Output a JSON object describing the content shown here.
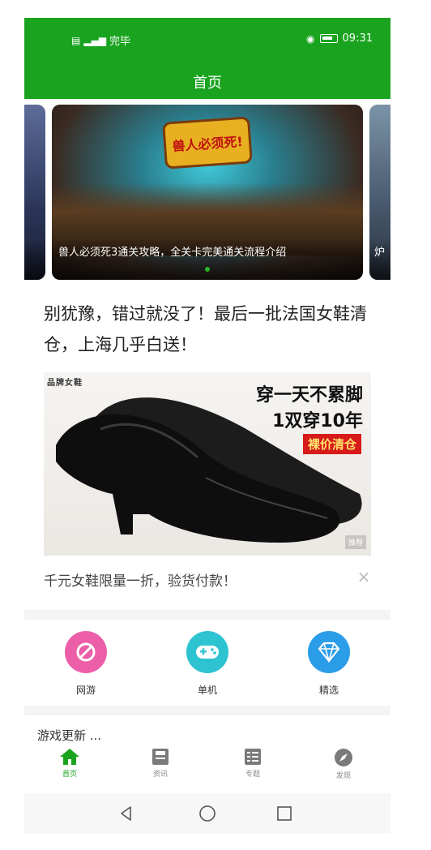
{
  "status_bar": {
    "left_text": "完毕",
    "time": "09:31"
  },
  "app_bar": {
    "title": "首页"
  },
  "carousel": {
    "left_caption": "...",
    "main_logo_text": "兽人必须死!",
    "main_caption": "兽人必须死3通关攻略，全关卡完美通关流程介绍",
    "right_caption": "炉"
  },
  "ad": {
    "title": "别犹豫，错过就没了！最后一批法国女鞋清仓，上海几乎白送！",
    "brand": "品牌女鞋",
    "slogan_line1": "穿一天不累脚",
    "slogan_line2": "1双穿10年",
    "tag": "裸价清仓",
    "watermark": "推荐",
    "description": "千元女鞋限量一折，验货付款！",
    "close_glyph": "×"
  },
  "shortcuts": [
    {
      "label": "网游",
      "icon": "ring-icon",
      "color": "#ec5fa8"
    },
    {
      "label": "单机",
      "icon": "gamepad-icon",
      "color": "#2ec3d0"
    },
    {
      "label": "精选",
      "icon": "diamond-icon",
      "color": "#2b9de8"
    }
  ],
  "section": {
    "title": "游戏更新 ..."
  },
  "tabs": [
    {
      "label": "首页",
      "icon": "home-icon",
      "active": true
    },
    {
      "label": "资讯",
      "icon": "news-icon",
      "active": false
    },
    {
      "label": "专题",
      "icon": "topic-icon",
      "active": false
    },
    {
      "label": "发现",
      "icon": "compass-icon",
      "active": false
    }
  ],
  "colors": {
    "brand_green": "#1aa31f",
    "text_dark": "#222222",
    "divider": "#f4f4f4"
  }
}
